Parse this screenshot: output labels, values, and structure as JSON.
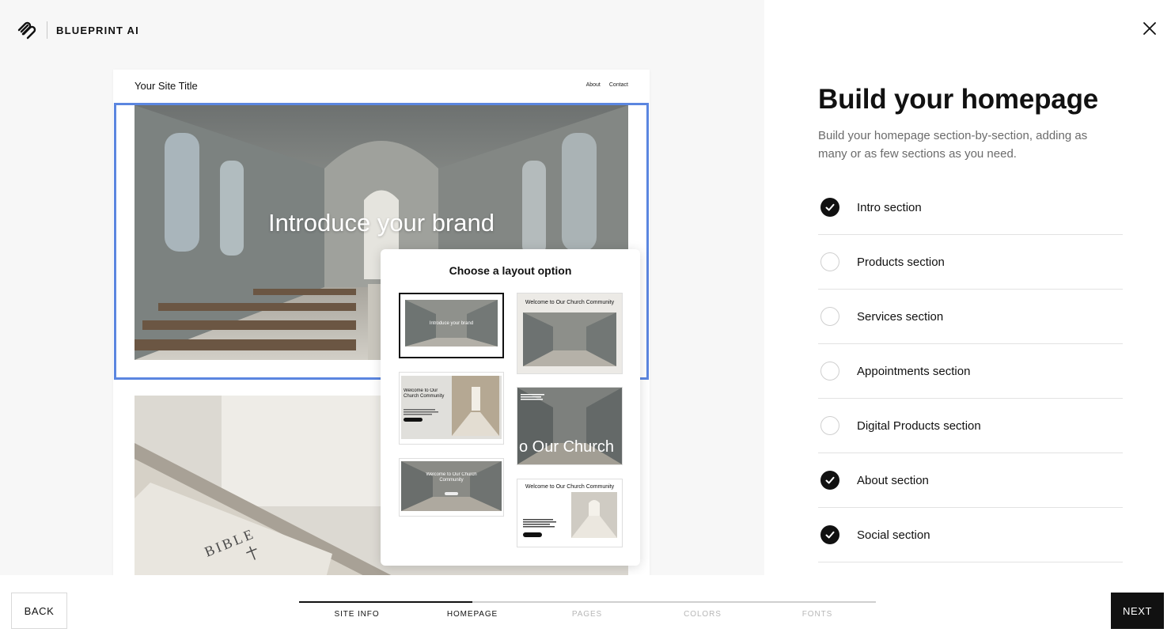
{
  "app": {
    "brand_name": "BLUEPRINT AI"
  },
  "preview": {
    "site_title": "Your Site Title",
    "nav": [
      "About",
      "Contact"
    ],
    "intro_heading": "Introduce your brand",
    "about_image_text": "BIBLE"
  },
  "layout_panel": {
    "title": "Choose a layout option",
    "selected_index": 0,
    "options": [
      {
        "text": "Introduce your brand"
      },
      {
        "text": "Welcome to Our Church Community"
      },
      {
        "text": "Welcome to Our Church Community"
      },
      {
        "text": "o Our Church"
      },
      {
        "text": "Welcome to Our Church Community"
      },
      {
        "text": "Welcome to Our Church Community"
      }
    ]
  },
  "panel": {
    "heading": "Build your homepage",
    "description": "Build your homepage section-by-section, adding as many or as few sections as you need.",
    "sections": [
      {
        "label": "Intro section",
        "checked": true
      },
      {
        "label": "Products section",
        "checked": false
      },
      {
        "label": "Services section",
        "checked": false
      },
      {
        "label": "Appointments section",
        "checked": false
      },
      {
        "label": "Digital Products section",
        "checked": false
      },
      {
        "label": "About section",
        "checked": true
      },
      {
        "label": "Social section",
        "checked": true
      }
    ]
  },
  "footer": {
    "back_label": "BACK",
    "next_label": "NEXT",
    "progress": 0.3,
    "steps": [
      {
        "label": "SITE INFO",
        "done": true
      },
      {
        "label": "HOMEPAGE",
        "done": true
      },
      {
        "label": "PAGES",
        "done": false
      },
      {
        "label": "COLORS",
        "done": false
      },
      {
        "label": "FONTS",
        "done": false
      }
    ]
  },
  "icons": {
    "logo": "blueprint-logo-icon",
    "close": "close-icon",
    "check": "check-icon"
  },
  "colors": {
    "selection_outline": "#5b86e0",
    "accent": "#111111"
  }
}
